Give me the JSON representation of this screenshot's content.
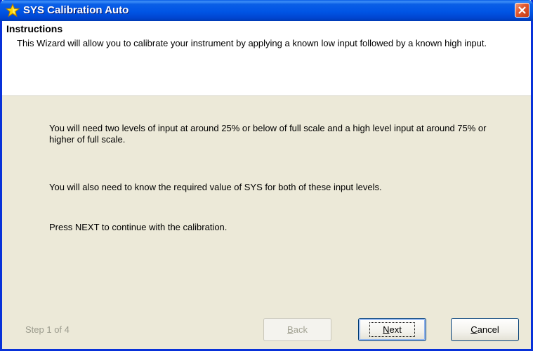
{
  "window": {
    "title": "SYS Calibration Auto"
  },
  "header": {
    "title": "Instructions",
    "description": "This Wizard will allow you to calibrate your instrument by applying a known low input followed by a known high input."
  },
  "body": {
    "paragraph1": "You will need two levels of input at around 25% or below of full scale and a high level input at around 75% or higher of full scale.",
    "paragraph2": "You will also need to know the required value of SYS for both of these input levels.",
    "paragraph3": "Press NEXT to continue with the calibration."
  },
  "footer": {
    "step_label": "Step 1 of 4",
    "back": {
      "accel": "B",
      "rest": "ack",
      "enabled": false
    },
    "next": {
      "accel": "N",
      "rest": "ext",
      "enabled": true,
      "default": true
    },
    "cancel": {
      "accel": "C",
      "rest": "ancel",
      "enabled": true
    }
  },
  "colors": {
    "title_bar": "#0055e5",
    "dialog_bg": "#ece9d8",
    "close_button": "#e35a30",
    "icon_star": "#ffd700"
  },
  "icons": {
    "title_icon": "star-icon",
    "close_icon": "close-icon"
  }
}
